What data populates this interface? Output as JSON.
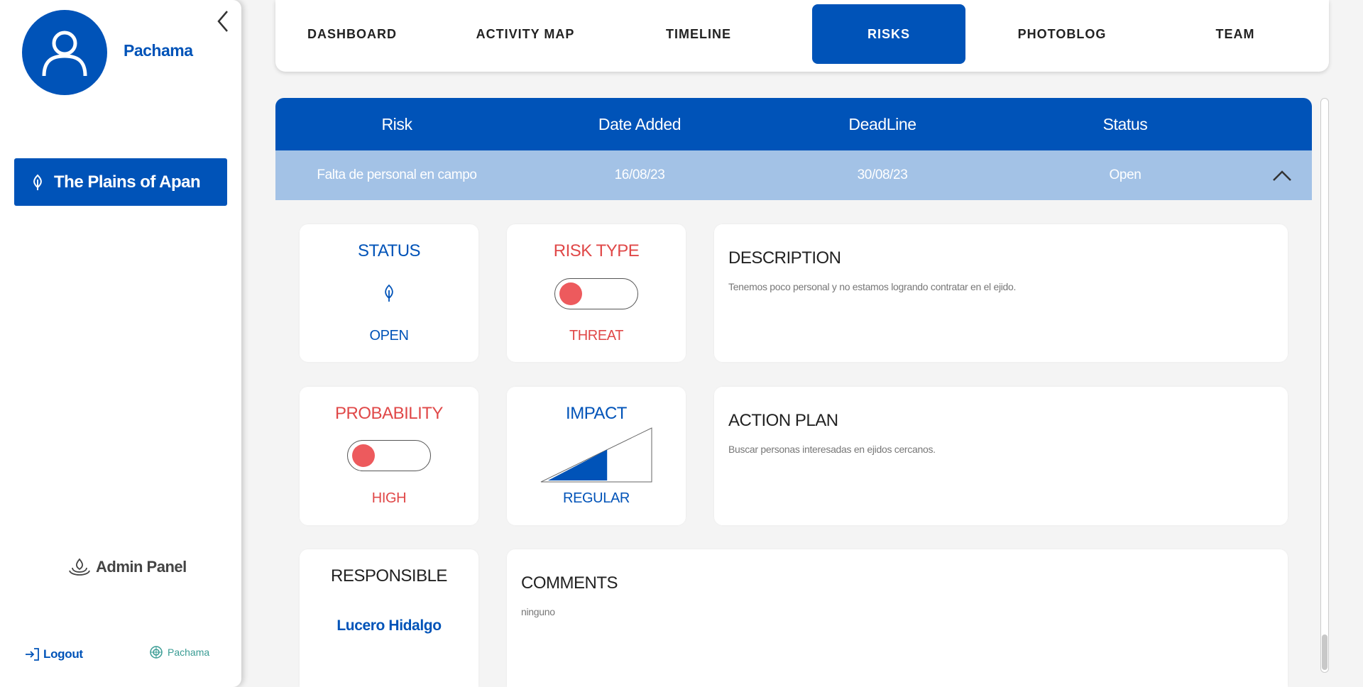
{
  "user": {
    "name": "Pachama"
  },
  "sidebar": {
    "project_label": "The Plains of Apan",
    "admin_label": "Admin Panel",
    "logout_label": "Logout",
    "brand_label": "Pachama"
  },
  "tabs": [
    {
      "label": "DASHBOARD"
    },
    {
      "label": "ACTIVITY MAP"
    },
    {
      "label": "TIMELINE"
    },
    {
      "label": "RISKS",
      "active": true
    },
    {
      "label": "PHOTOBLOG"
    },
    {
      "label": "TEAM"
    }
  ],
  "table": {
    "headers": [
      "Risk",
      "Date Added",
      "DeadLine",
      "Status"
    ],
    "row": {
      "risk": "Falta de personal en campo",
      "date_added": "16/08/23",
      "deadline": "30/08/23",
      "status": "Open"
    }
  },
  "details": {
    "status": {
      "title": "STATUS",
      "value": "OPEN"
    },
    "risk_type": {
      "title": "RISK TYPE",
      "value": "THREAT"
    },
    "description": {
      "title": "DESCRIPTION",
      "text": "Tenemos poco personal y no estamos logrando contratar en el ejido."
    },
    "probability": {
      "title": "PROBABILITY",
      "value": "HIGH"
    },
    "impact": {
      "title": "IMPACT",
      "value": "REGULAR",
      "level_fraction": 0.57
    },
    "action_plan": {
      "title": "ACTION PLAN",
      "text": "Buscar personas interesadas en ejidos cercanos."
    },
    "responsible": {
      "title": "RESPONSIBLE",
      "name": "Lucero Hidalgo"
    },
    "comments": {
      "title": "COMMENTS",
      "text": "ninguno"
    }
  },
  "colors": {
    "primary": "#0053b8",
    "row_highlight": "#a3c2e6",
    "danger": "#e04848",
    "toggle_knob": "#ed5a5d",
    "brand_teal": "#3a9c94"
  },
  "icons": {
    "collapse": "chevron-left-icon",
    "avatar": "user-icon",
    "project": "leaf-icon",
    "admin": "drop-icon",
    "logout": "login-arrow-icon",
    "row_toggle": "chevron-up-icon"
  }
}
